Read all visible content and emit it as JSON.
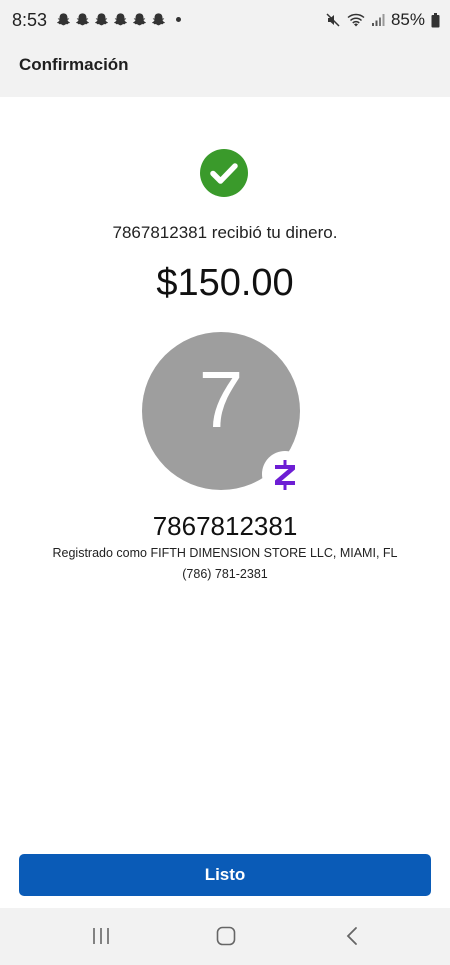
{
  "status_bar": {
    "time": "8:53",
    "battery": "85%",
    "icons": [
      "snapchat-icon",
      "snapchat-icon",
      "snapchat-icon",
      "snapchat-icon",
      "snapchat-icon",
      "snapchat-icon",
      "notification-dot",
      "mute-icon",
      "wifi-icon",
      "signal-icon",
      "battery-icon"
    ]
  },
  "header": {
    "title": "Confirmación"
  },
  "confirmation": {
    "icon": "check-circle-icon",
    "message": "7867812381 recibió tu dinero.",
    "amount": "$150.00"
  },
  "recipient": {
    "initial": "7",
    "badge_icon": "zelle-icon",
    "name": "7867812381",
    "registered_as": "Registrado como FIFTH DIMENSION STORE LLC, MIAMI, FL",
    "phone": "(786) 781-2381"
  },
  "actions": {
    "done_label": "Listo"
  },
  "nav": {
    "icons": [
      "recent-apps-icon",
      "home-icon",
      "back-icon"
    ]
  },
  "colors": {
    "success": "#3a9a2b",
    "primary_button": "#0a5bb7",
    "zelle": "#6d1ed4",
    "avatar_bg": "#9e9e9e"
  }
}
